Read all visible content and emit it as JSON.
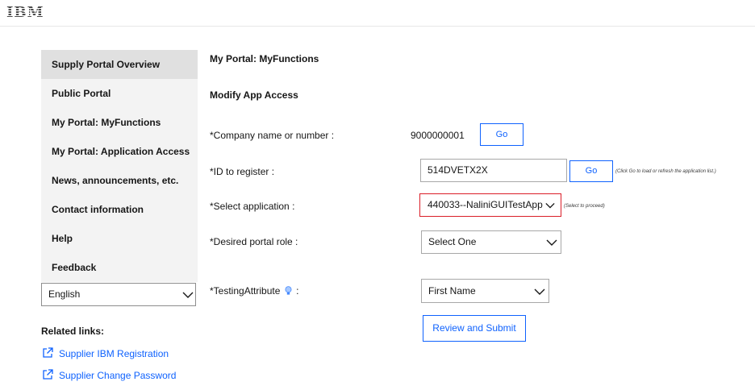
{
  "header": {
    "logo_text": "IBM"
  },
  "sidebar": {
    "items": [
      {
        "label": "Supply Portal Overview"
      },
      {
        "label": "Public Portal"
      },
      {
        "label": "My Portal: MyFunctions"
      },
      {
        "label": "My Portal: Application Access"
      },
      {
        "label": "News, announcements, etc."
      },
      {
        "label": "Contact information"
      },
      {
        "label": "Help"
      },
      {
        "label": "Feedback"
      }
    ],
    "language": "English"
  },
  "related": {
    "title": "Related links:",
    "links": [
      {
        "label": "Supplier IBM Registration"
      },
      {
        "label": "Supplier Change Password"
      }
    ]
  },
  "main": {
    "section_title": "My Portal: MyFunctions",
    "page_title": "Modify App Access",
    "company": {
      "label": "*Company name or number :",
      "value": "9000000001",
      "go_label": "Go"
    },
    "id_register": {
      "label": "*ID to register :",
      "value": "514DVETX2X",
      "go_label": "Go",
      "hint": "(Click Go to load or refresh the application list.)"
    },
    "application": {
      "label": "*Select application :",
      "value": "440033--NaliniGUITestApp",
      "hint": "(Select to proceed)"
    },
    "portal_role": {
      "label": "*Desired portal role :",
      "value": "Select One"
    },
    "testing_attr": {
      "label": "*TestingAttribute",
      "suffix": ":",
      "value": "First Name"
    },
    "submit_label": "Review and Submit"
  },
  "colors": {
    "link": "#0f62fe",
    "highlight": "#da1e28",
    "active_nav": "#e0e0e0",
    "nav_bg": "#f3f3f3"
  },
  "icons": {
    "chevron": "chevron-down-icon",
    "external": "launch-icon",
    "info": "lightbulb-icon"
  }
}
